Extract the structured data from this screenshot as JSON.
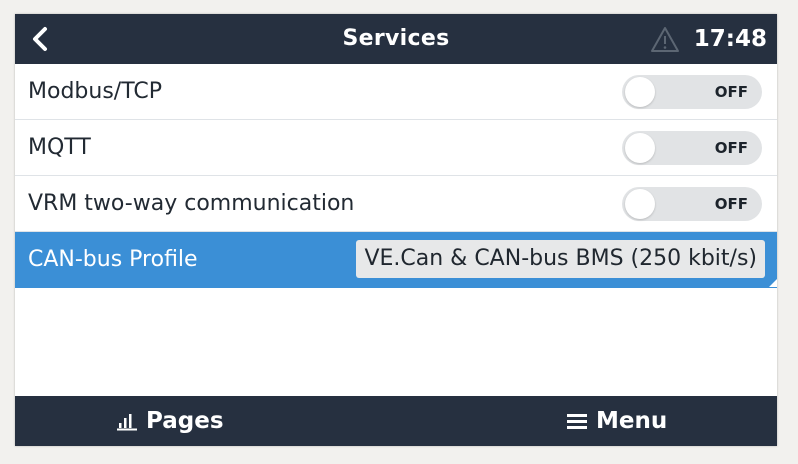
{
  "topbar": {
    "title": "Services",
    "time": "17:48",
    "back_icon": "chevron-left-icon",
    "alarm_icon": "warning-triangle-icon"
  },
  "rows": [
    {
      "label": "Modbus/TCP",
      "state": "OFF"
    },
    {
      "label": "MQTT",
      "state": "OFF"
    },
    {
      "label": "VRM two-way communication",
      "state": "OFF"
    }
  ],
  "canbus": {
    "label": "CAN-bus Profile",
    "value": "VE.Can & CAN-bus BMS (250 kbit/s)"
  },
  "bottombar": {
    "pages_label": "Pages",
    "menu_label": "Menu",
    "pages_icon": "bar-chart-icon",
    "menu_icon": "hamburger-menu-icon"
  },
  "colors": {
    "bar_background": "#263040",
    "selection": "#3b8fd6",
    "toggle_off": "#e1e3e5"
  }
}
